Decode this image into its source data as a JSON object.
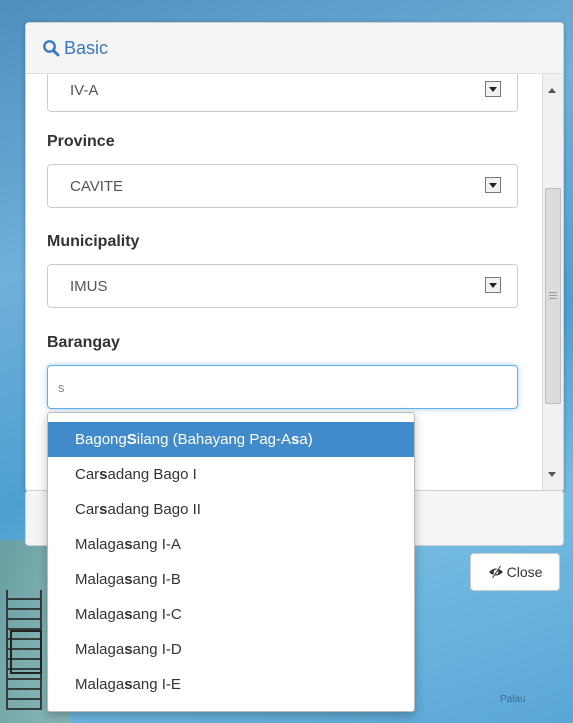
{
  "panel": {
    "title": "Basic",
    "search_icon": "search-icon"
  },
  "fields": {
    "region": {
      "value": "IV-A"
    },
    "province": {
      "label": "Province",
      "value": "CAVITE"
    },
    "municipality": {
      "label": "Municipality",
      "value": "IMUS"
    },
    "barangay": {
      "label": "Barangay",
      "value": "s"
    }
  },
  "suggestions": [
    {
      "pre": "Bagong ",
      "match": "S",
      "post": "ilang (Bahayang Pag-A",
      "match2": "s",
      "post2": "a)"
    },
    {
      "pre": "Car",
      "match": "s",
      "post": "adang Bago I"
    },
    {
      "pre": "Car",
      "match": "s",
      "post": "adang Bago II"
    },
    {
      "pre": "Malaga",
      "match": "s",
      "post": "ang I-A"
    },
    {
      "pre": "Malaga",
      "match": "s",
      "post": "ang I-B"
    },
    {
      "pre": "Malaga",
      "match": "s",
      "post": "ang I-C"
    },
    {
      "pre": "Malaga",
      "match": "s",
      "post": "ang I-D"
    },
    {
      "pre": "Malaga",
      "match": "s",
      "post": "ang I-E"
    }
  ],
  "close_button": {
    "label": "Close",
    "icon": "eye-slash-icon"
  },
  "map": {
    "place_label": "Palau"
  },
  "colors": {
    "accent": "#428bca",
    "header_text": "#3a78c2"
  }
}
